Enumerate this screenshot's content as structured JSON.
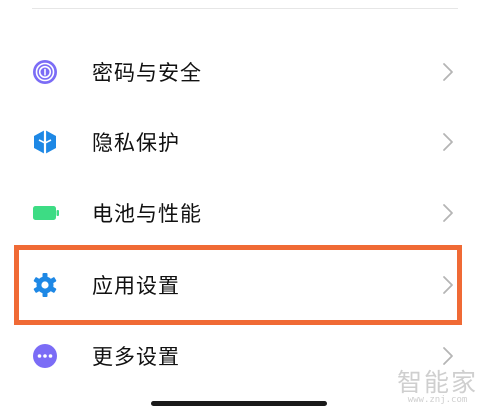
{
  "settings_list": {
    "items": [
      {
        "label": "密码与安全",
        "icon": "fingerprint-icon"
      },
      {
        "label": "隐私保护",
        "icon": "privacy-shield-icon"
      },
      {
        "label": "电池与性能",
        "icon": "battery-icon"
      },
      {
        "label": "应用设置",
        "icon": "gear-icon",
        "highlighted": true
      },
      {
        "label": "更多设置",
        "icon": "more-dots-icon"
      }
    ]
  },
  "highlight": {
    "color": "#f06a35"
  },
  "watermark": {
    "title": "智能家",
    "url": "www.znj.com"
  },
  "colors": {
    "fingerprint": "#7b6cf6",
    "privacy": "#1e88e5",
    "battery": "#3ddc84",
    "gear": "#1e88e5",
    "more": "#7b6cf6",
    "chevron": "#b5b5b5"
  }
}
